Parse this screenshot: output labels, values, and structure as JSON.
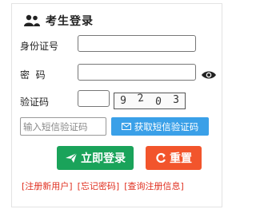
{
  "header": {
    "title": "考生登录",
    "icon": "users-icon"
  },
  "form": {
    "id_label": "身份证号",
    "password_label": "密  码",
    "captcha_label": "验证码",
    "captcha_digits": [
      "9",
      "2",
      "0",
      "3"
    ],
    "sms_placeholder": "输入短信验证码",
    "sms_button_label": "获取短信验证码"
  },
  "actions": {
    "login_label": "立即登录",
    "reset_label": "重置"
  },
  "links": {
    "register": "[注册新用户]",
    "forgot": "[忘记密码]",
    "query": "[查询注册信息]"
  },
  "colors": {
    "login": "#1aa35a",
    "reset": "#f2552c",
    "sms": "#3aa0e8",
    "link": "#e03020"
  }
}
